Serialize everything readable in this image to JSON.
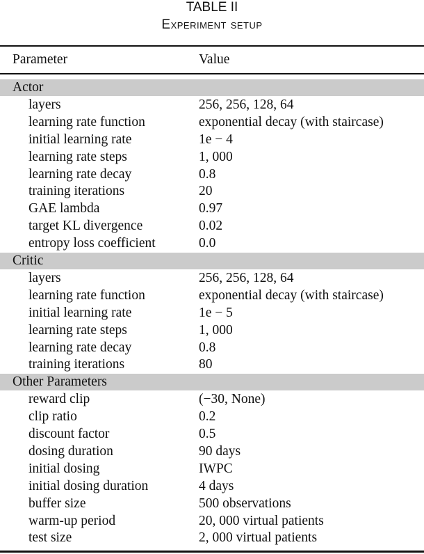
{
  "caption": {
    "label": "TABLE II",
    "title": "Experiment setup"
  },
  "header": {
    "parameter": "Parameter",
    "value": "Value"
  },
  "sections": [
    {
      "name": "Actor",
      "rows": [
        {
          "parameter": "layers",
          "value": "256, 256, 128, 64"
        },
        {
          "parameter": "learning rate function",
          "value": "exponential decay (with staircase)"
        },
        {
          "parameter": "initial learning rate",
          "value": "1e − 4"
        },
        {
          "parameter": "learning rate steps",
          "value": "1, 000"
        },
        {
          "parameter": "learning rate decay",
          "value": "0.8"
        },
        {
          "parameter": "training iterations",
          "value": "20"
        },
        {
          "parameter": "GAE lambda",
          "value": "0.97"
        },
        {
          "parameter": "target KL divergence",
          "value": "0.02"
        },
        {
          "parameter": "entropy loss coefficient",
          "value": "0.0"
        }
      ]
    },
    {
      "name": "Critic",
      "rows": [
        {
          "parameter": "layers",
          "value": "256, 256, 128, 64"
        },
        {
          "parameter": "learning rate function",
          "value": "exponential decay (with staircase)"
        },
        {
          "parameter": "initial learning rate",
          "value": "1e − 5"
        },
        {
          "parameter": "learning rate steps",
          "value": "1, 000"
        },
        {
          "parameter": "learning rate decay",
          "value": "0.8"
        },
        {
          "parameter": "training iterations",
          "value": "80"
        }
      ]
    },
    {
      "name": "Other Parameters",
      "rows": [
        {
          "parameter": "reward clip",
          "value": "(−30, None)"
        },
        {
          "parameter": "clip ratio",
          "value": "0.2"
        },
        {
          "parameter": "discount factor",
          "value": "0.5"
        },
        {
          "parameter": "dosing duration",
          "value": "90 days"
        },
        {
          "parameter": "initial dosing",
          "value": "IWPC"
        },
        {
          "parameter": "initial dosing duration",
          "value": "4 days"
        },
        {
          "parameter": "buffer size",
          "value": "500 observations"
        },
        {
          "parameter": "warm-up period",
          "value": "20, 000 virtual patients"
        },
        {
          "parameter": "test size",
          "value": "2, 000 virtual patients"
        }
      ]
    }
  ]
}
